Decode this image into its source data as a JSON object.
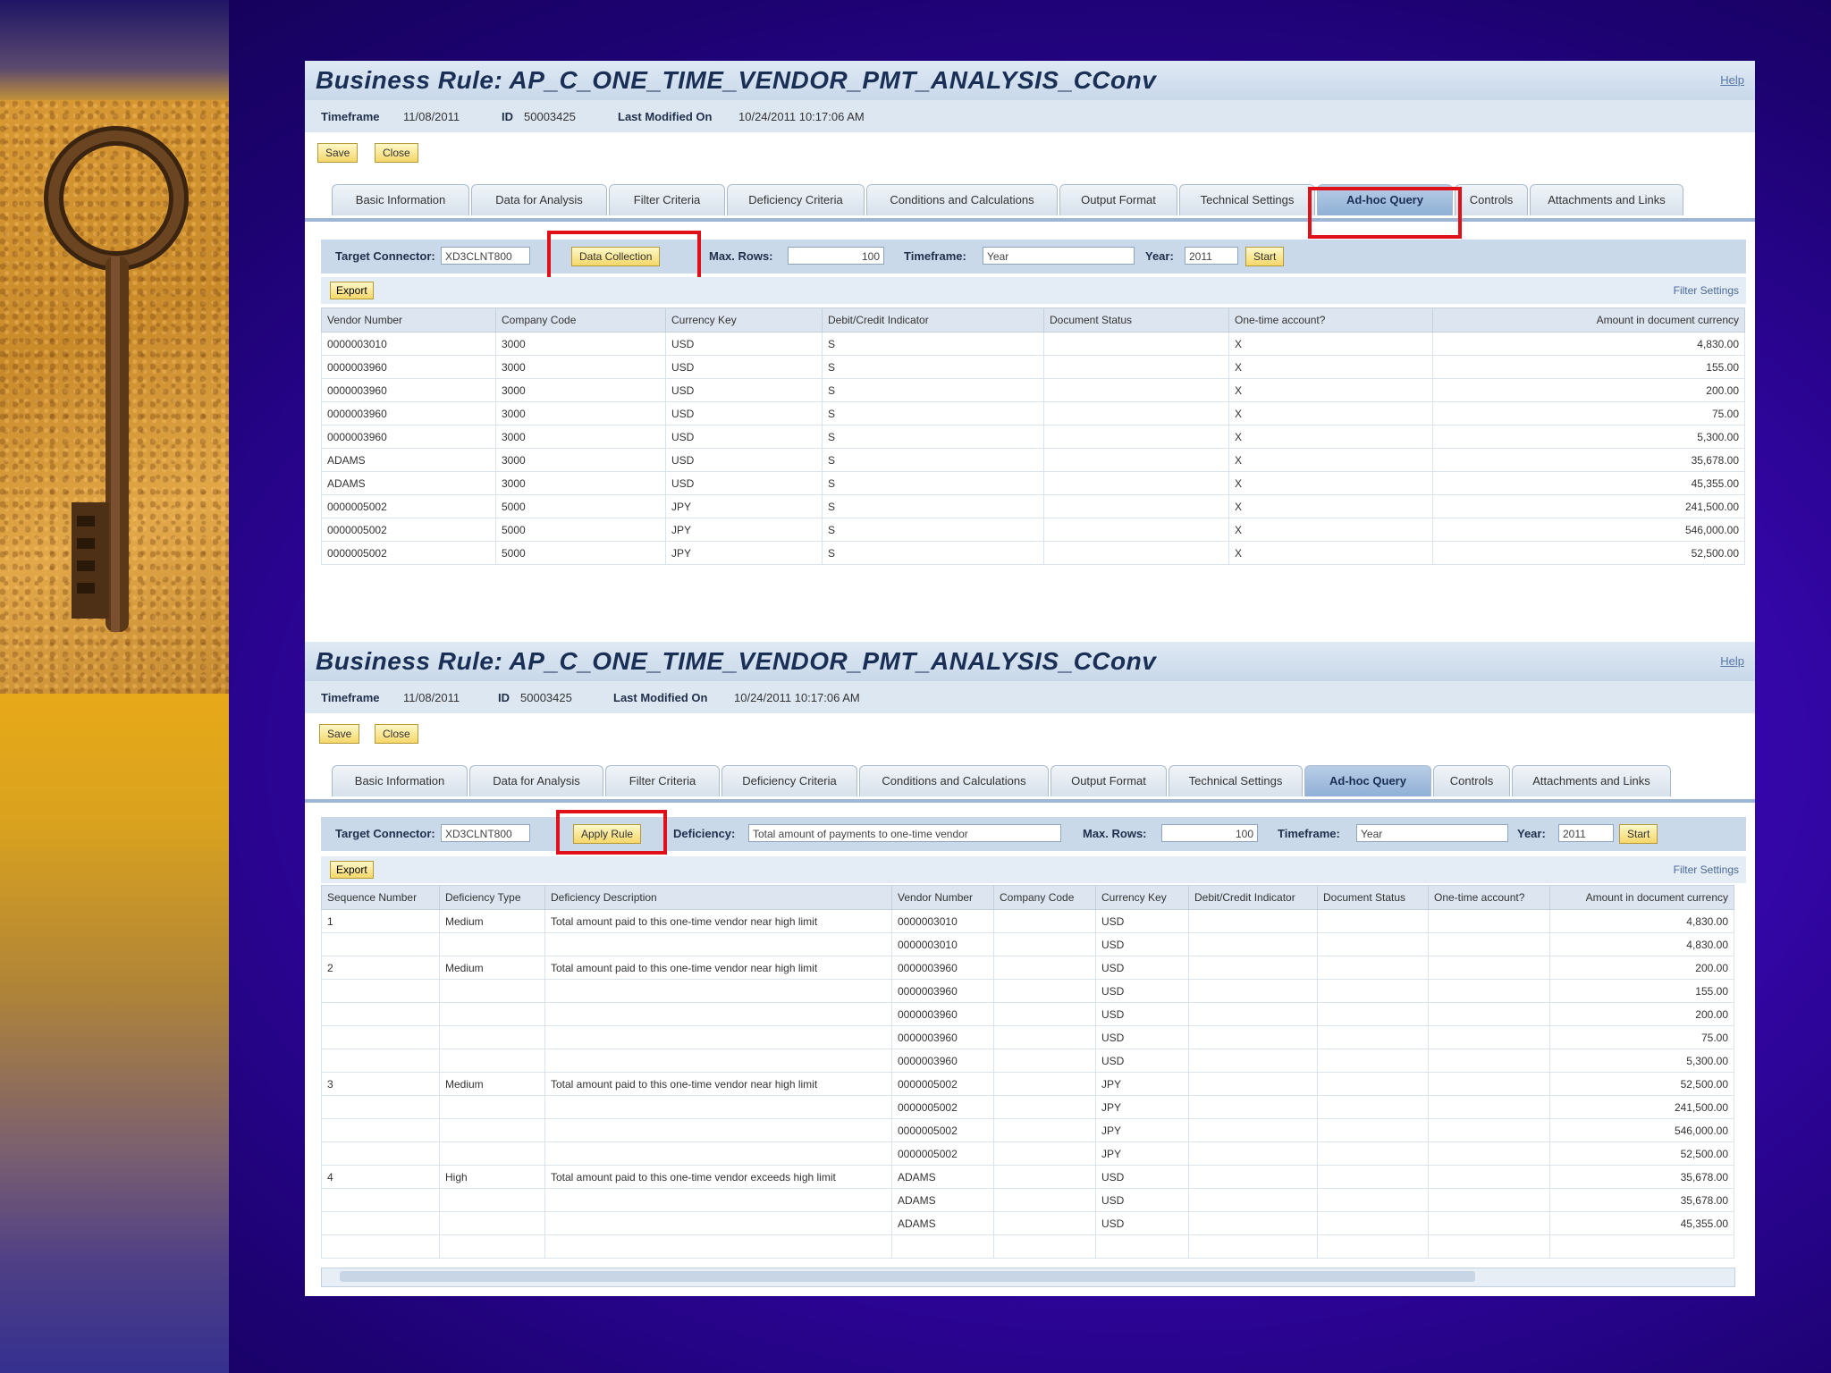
{
  "colors": {
    "accent_red": "#e01018",
    "header_blue": "#1a2f55",
    "button_yellow": "#f5d76a",
    "slide_purple": "#3406a8"
  },
  "decor": {
    "image": "antique-key-on-sand"
  },
  "screens": [
    {
      "title": "Business Rule: AP_C_ONE_TIME_VENDOR_PMT_ANALYSIS_CConv",
      "help": "Help",
      "info": {
        "timeframe_label": "Timeframe",
        "timeframe_value": "11/08/2011",
        "id_label": "ID",
        "id_value": "50003425",
        "modified_label": "Last Modified On",
        "modified_value": "10/24/2011 10:17:06 AM"
      },
      "save": "Save",
      "close": "Close",
      "tabs": [
        "Basic Information",
        "Data for Analysis",
        "Filter Criteria",
        "Deficiency Criteria",
        "Conditions and Calculations",
        "Output Format",
        "Technical Settings",
        "Ad-hoc Query",
        "Controls",
        "Attachments and Links"
      ],
      "active_tab": "Ad-hoc Query",
      "query": {
        "target_label": "Target Connector:",
        "target_value": "XD3CLNT800",
        "action_button": "Data Collection",
        "maxrows_label": "Max. Rows:",
        "maxrows_value": "100",
        "timeframe_label": "Timeframe:",
        "timeframe_value": "Year",
        "year_label": "Year:",
        "year_value": "2011",
        "start": "Start"
      },
      "export": "Export",
      "filter_settings": "Filter  Settings",
      "columns": [
        "Vendor Number",
        "Company Code",
        "Currency Key",
        "Debit/Credit Indicator",
        "Document Status",
        "One-time account?",
        "Amount in document currency"
      ],
      "rows": [
        [
          "0000003010",
          "3000",
          "USD",
          "S",
          "",
          "X",
          "4,830.00"
        ],
        [
          "0000003960",
          "3000",
          "USD",
          "S",
          "",
          "X",
          "155.00"
        ],
        [
          "0000003960",
          "3000",
          "USD",
          "S",
          "",
          "X",
          "200.00"
        ],
        [
          "0000003960",
          "3000",
          "USD",
          "S",
          "",
          "X",
          "75.00"
        ],
        [
          "0000003960",
          "3000",
          "USD",
          "S",
          "",
          "X",
          "5,300.00"
        ],
        [
          "ADAMS",
          "3000",
          "USD",
          "S",
          "",
          "X",
          "35,678.00"
        ],
        [
          "ADAMS",
          "3000",
          "USD",
          "S",
          "",
          "X",
          "45,355.00"
        ],
        [
          "0000005002",
          "5000",
          "JPY",
          "S",
          "",
          "X",
          "241,500.00"
        ],
        [
          "0000005002",
          "5000",
          "JPY",
          "S",
          "",
          "X",
          "546,000.00"
        ],
        [
          "0000005002",
          "5000",
          "JPY",
          "S",
          "",
          "X",
          "52,500.00"
        ]
      ]
    },
    {
      "title": "Business Rule: AP_C_ONE_TIME_VENDOR_PMT_ANALYSIS_CConv",
      "help": "Help",
      "info": {
        "timeframe_label": "Timeframe",
        "timeframe_value": "11/08/2011",
        "id_label": "ID",
        "id_value": "50003425",
        "modified_label": "Last Modified On",
        "modified_value": "10/24/2011 10:17:06 AM"
      },
      "save": "Save",
      "close": "Close",
      "tabs": [
        "Basic Information",
        "Data for Analysis",
        "Filter Criteria",
        "Deficiency Criteria",
        "Conditions and Calculations",
        "Output Format",
        "Technical Settings",
        "Ad-hoc Query",
        "Controls",
        "Attachments and Links"
      ],
      "active_tab": "Ad-hoc Query",
      "query": {
        "target_label": "Target Connector:",
        "target_value": "XD3CLNT800",
        "action_button": "Apply Rule",
        "deficiency_label": "Deficiency:",
        "deficiency_value": "Total amount of payments to one-time vendor",
        "maxrows_label": "Max. Rows:",
        "maxrows_value": "100",
        "timeframe_label": "Timeframe:",
        "timeframe_value": "Year",
        "year_label": "Year:",
        "year_value": "2011",
        "start": "Start"
      },
      "export": "Export",
      "filter_settings": "Filter  Settings",
      "columns": [
        "Sequence Number",
        "Deficiency Type",
        "Deficiency Description",
        "Vendor Number",
        "Company Code",
        "Currency Key",
        "Debit/Credit Indicator",
        "Document Status",
        "One-time account?",
        "Amount in document currency"
      ],
      "rows": [
        [
          "1",
          "Medium",
          "Total amount paid to this one-time vendor near high limit",
          "0000003010",
          "",
          "USD",
          "",
          "",
          "",
          "4,830.00"
        ],
        [
          "",
          "",
          "",
          "0000003010",
          "",
          "USD",
          "",
          "",
          "",
          "4,830.00"
        ],
        [
          "2",
          "Medium",
          "Total amount paid to this one-time vendor near high limit",
          "0000003960",
          "",
          "USD",
          "",
          "",
          "",
          "200.00"
        ],
        [
          "",
          "",
          "",
          "0000003960",
          "",
          "USD",
          "",
          "",
          "",
          "155.00"
        ],
        [
          "",
          "",
          "",
          "0000003960",
          "",
          "USD",
          "",
          "",
          "",
          "200.00"
        ],
        [
          "",
          "",
          "",
          "0000003960",
          "",
          "USD",
          "",
          "",
          "",
          "75.00"
        ],
        [
          "",
          "",
          "",
          "0000003960",
          "",
          "USD",
          "",
          "",
          "",
          "5,300.00"
        ],
        [
          "3",
          "Medium",
          "Total amount paid to this one-time vendor near high limit",
          "0000005002",
          "",
          "JPY",
          "",
          "",
          "",
          "52,500.00"
        ],
        [
          "",
          "",
          "",
          "0000005002",
          "",
          "JPY",
          "",
          "",
          "",
          "241,500.00"
        ],
        [
          "",
          "",
          "",
          "0000005002",
          "",
          "JPY",
          "",
          "",
          "",
          "546,000.00"
        ],
        [
          "",
          "",
          "",
          "0000005002",
          "",
          "JPY",
          "",
          "",
          "",
          "52,500.00"
        ],
        [
          "4",
          "High",
          "Total amount paid to this one-time vendor exceeds high limit",
          "ADAMS",
          "",
          "USD",
          "",
          "",
          "",
          "35,678.00"
        ],
        [
          "",
          "",
          "",
          "ADAMS",
          "",
          "USD",
          "",
          "",
          "",
          "35,678.00"
        ],
        [
          "",
          "",
          "",
          "ADAMS",
          "",
          "USD",
          "",
          "",
          "",
          "45,355.00"
        ],
        [
          "",
          "",
          "",
          "",
          "",
          "",
          "",
          "",
          "",
          ""
        ]
      ]
    }
  ]
}
